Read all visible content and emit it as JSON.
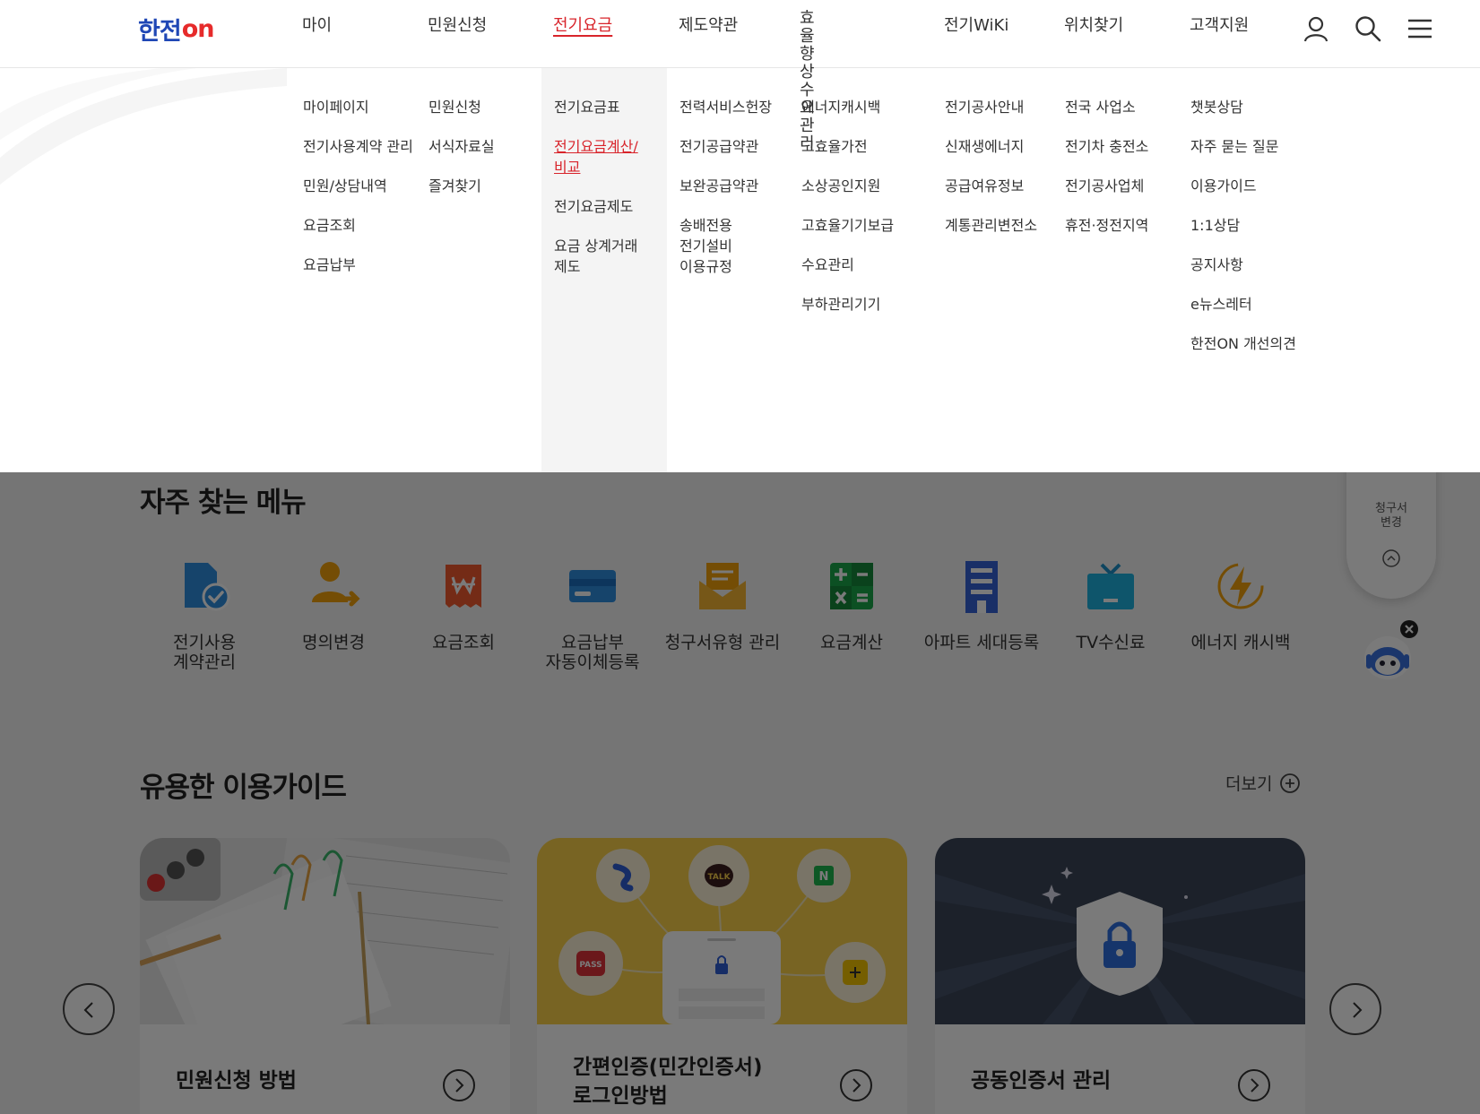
{
  "header": {
    "logo_main": "한전",
    "logo_on": "on",
    "nav": [
      {
        "label": "마이"
      },
      {
        "label": "민원신청"
      },
      {
        "label": "전기요금",
        "active": true
      },
      {
        "label": "제도약관"
      },
      {
        "label": "효율향상\n수요관리"
      },
      {
        "label": "전기WiKi"
      },
      {
        "label": "위치찾기"
      },
      {
        "label": "고객지원"
      }
    ],
    "icons": [
      "user-icon",
      "search-icon",
      "menu-icon"
    ]
  },
  "mega_menu": {
    "columns": [
      [
        "마이페이지",
        "전기사용계약 관리",
        "민원/상담내역",
        "요금조회",
        "요금납부"
      ],
      [
        "민원신청",
        "서식자료실",
        "즐겨찾기"
      ],
      [
        "전기요금표",
        "전기요금계산/비교",
        "전기요금제도",
        "요금 상계거래 제도"
      ],
      [
        "전력서비스헌장",
        "전기공급약관",
        "보완공급약관",
        "송배전용 전기설비 이용규정"
      ],
      [
        "에너지캐시백",
        "고효율가전",
        "소상공인지원",
        "고효율기기보급",
        "수요관리",
        "부하관리기기"
      ],
      [
        "전기공사안내",
        "신재생에너지",
        "공급여유정보",
        "계통관리변전소"
      ],
      [
        "전국 사업소",
        "전기차 충전소",
        "전기공사업체",
        "휴전·정전지역"
      ],
      [
        "챗봇상담",
        "자주 묻는 질문",
        "이용가이드",
        "1:1상담",
        "공지사항",
        "e뉴스레터",
        "한전ON 개선의견"
      ]
    ],
    "current_item": "전기요금계산/비교"
  },
  "frequent": {
    "title": "자주 찾는 메뉴",
    "items": [
      {
        "label": "전기사용\n계약관리",
        "icon": "contract-document-icon"
      },
      {
        "label": "명의변경",
        "icon": "user-change-icon"
      },
      {
        "label": "요금조회",
        "icon": "bill-receipt-icon"
      },
      {
        "label": "요금납부\n자동이체등록",
        "icon": "credit-card-icon"
      },
      {
        "label": "청구서유형 관리",
        "icon": "envelope-icon"
      },
      {
        "label": "요금계산",
        "icon": "calculator-icon"
      },
      {
        "label": "아파트 세대등록",
        "icon": "apartment-icon"
      },
      {
        "label": "TV수신료",
        "icon": "tv-icon"
      },
      {
        "label": "에너지 캐시백",
        "icon": "energy-bolt-icon"
      }
    ]
  },
  "side": {
    "pill_text": "청구서\n변경",
    "icons": [
      "scroll-up-icon",
      "chatbot-icon",
      "close-icon"
    ]
  },
  "guide": {
    "title": "유용한 이용가이드",
    "more_label": "더보기",
    "cards": [
      {
        "title": "민원신청 방법"
      },
      {
        "title": "간편인증(민간인증서)\n로그인방법"
      },
      {
        "title": "공동인증서 관리"
      }
    ],
    "badges": [
      "TALK",
      "PASS",
      "N"
    ]
  },
  "colors": {
    "accent_red": "#d8242b",
    "brand_blue": "#1f47b5",
    "dim_overlay": "rgba(0,0,0,0.52)"
  }
}
